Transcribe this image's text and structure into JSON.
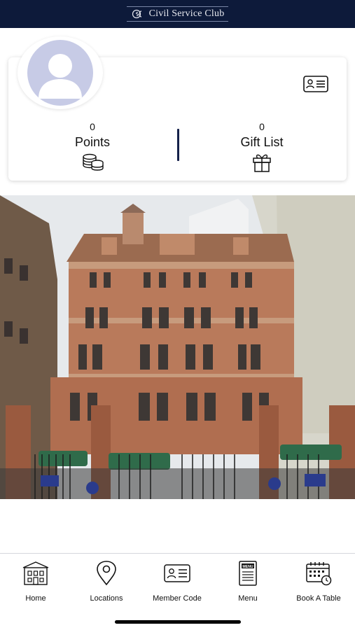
{
  "header": {
    "logo_text": "Civil Service Club"
  },
  "profile": {
    "points_value": "0",
    "points_label": "Points",
    "gift_value": "0",
    "gift_label": "Gift List"
  },
  "tabs": [
    {
      "label": "Home",
      "icon": "building-icon"
    },
    {
      "label": "Locations",
      "icon": "location-pin-icon"
    },
    {
      "label": "Member Code",
      "icon": "id-card-icon"
    },
    {
      "label": "Menu",
      "icon": "menu-book-icon"
    },
    {
      "label": "Book A Table",
      "icon": "calendar-icon"
    }
  ],
  "colors": {
    "header_bg": "#0d1a3a",
    "divider": "#15214a",
    "avatar_bg": "#c7cbe6"
  }
}
